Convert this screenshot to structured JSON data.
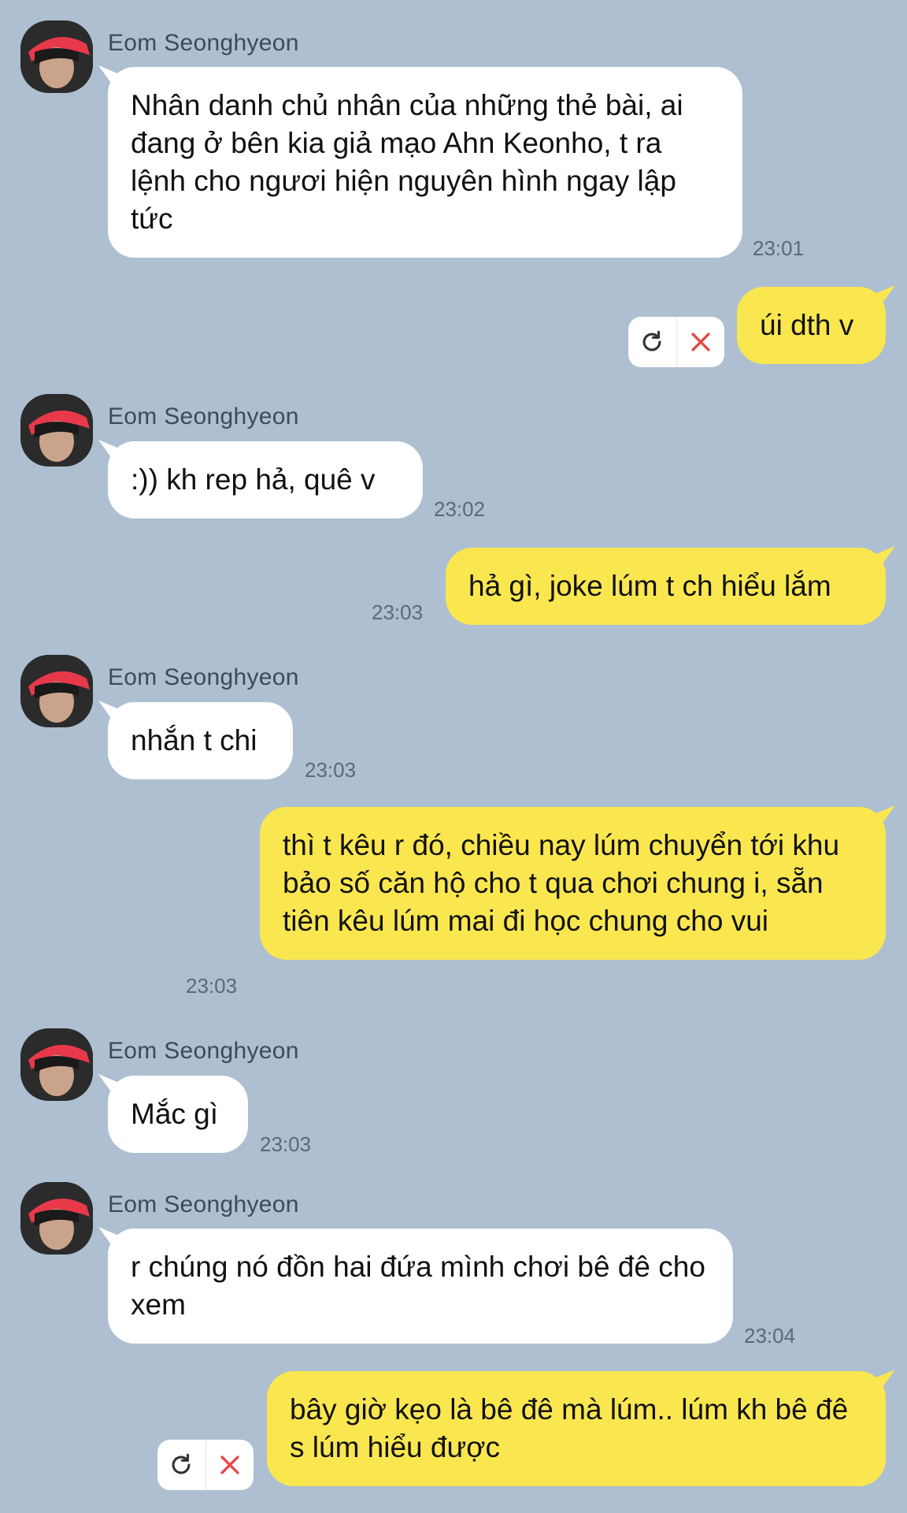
{
  "contact": {
    "name": "Eom Seonghyeon"
  },
  "messages": [
    {
      "from": "in",
      "text": "Nhân danh chủ nhân của những thẻ bài, ai đang ở bên kia giả mạo Ahn Keonho, t ra lệnh cho ngươi hiện nguyên hình ngay lập tức",
      "time": "23:01"
    },
    {
      "from": "out",
      "text": "úi dth v",
      "time": "",
      "failed": true
    },
    {
      "from": "in",
      "text": ":)) kh rep hả, quê v",
      "time": "23:02"
    },
    {
      "from": "out",
      "text": "hả gì, joke lúm t ch hiểu lắm",
      "time": "23:03"
    },
    {
      "from": "in",
      "text": "nhắn t chi",
      "time": "23:03"
    },
    {
      "from": "out",
      "text": "thì t kêu r đó, chiều nay lúm chuyển tới khu bảo số căn hộ cho t qua chơi chung i, sẵn tiên kêu lúm mai đi học chung cho vui",
      "time": "23:03"
    },
    {
      "from": "in",
      "text": "Mắc gì",
      "time": "23:03"
    },
    {
      "from": "in",
      "text": "r chúng nó đồn hai đứa mình chơi bê đê cho xem",
      "time": "23:04"
    },
    {
      "from": "out",
      "text": "bây giờ kẹo là bê đê mà lúm.. lúm kh bê đê s lúm hiểu được",
      "time": "",
      "failed": true
    }
  ]
}
